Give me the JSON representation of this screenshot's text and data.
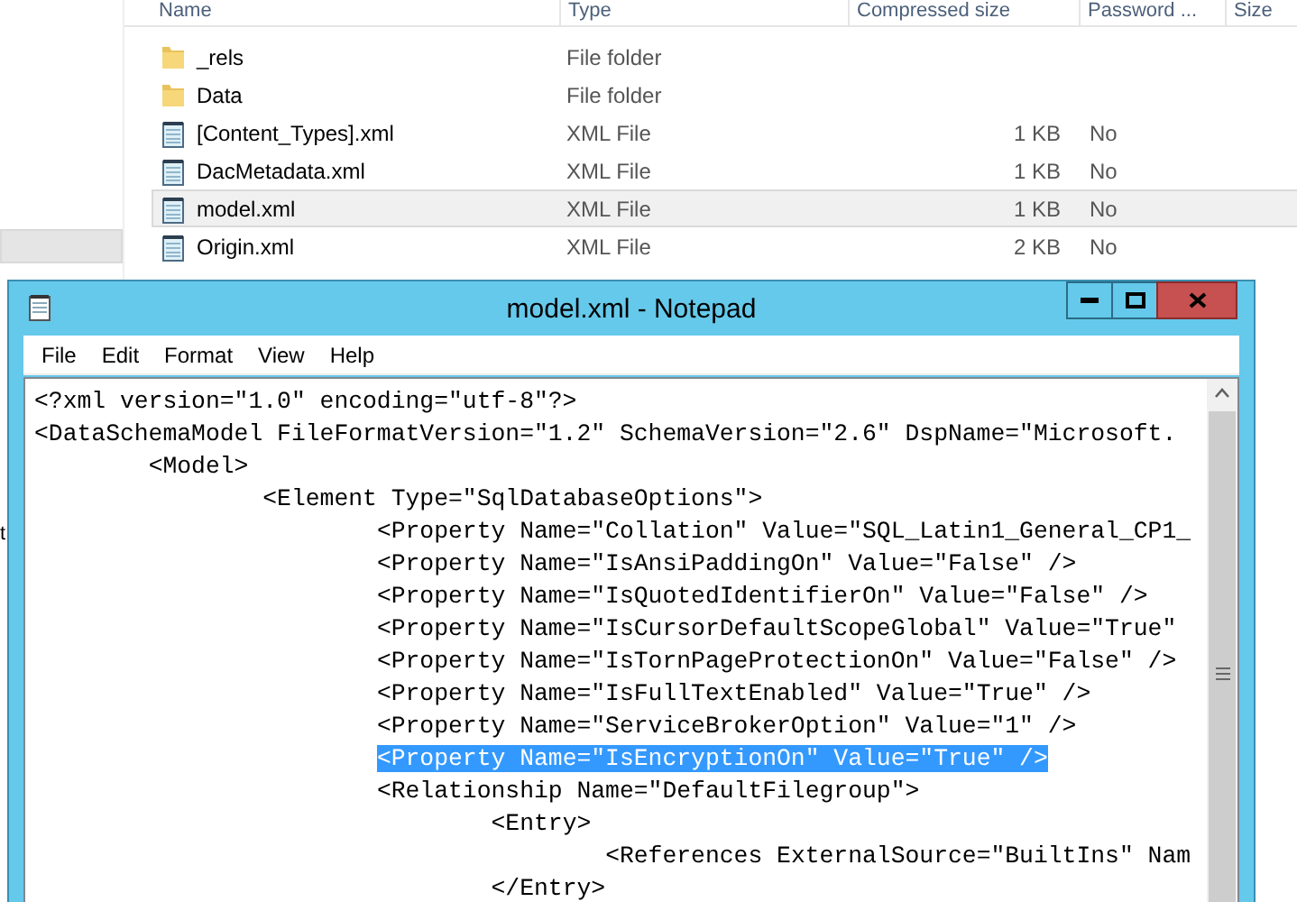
{
  "explorer": {
    "columns": [
      "Name",
      "Type",
      "Compressed size",
      "Password ...",
      "Size"
    ],
    "rows": [
      {
        "kind": "folder",
        "name": "_rels",
        "type": "File folder",
        "selected": false
      },
      {
        "kind": "folder",
        "name": "Data",
        "type": "File folder",
        "selected": false
      },
      {
        "kind": "file",
        "name": "[Content_Types].xml",
        "type": "XML File",
        "compressed_size": "1 KB",
        "password": "No",
        "selected": false
      },
      {
        "kind": "file",
        "name": "DacMetadata.xml",
        "type": "XML File",
        "compressed_size": "1 KB",
        "password": "No",
        "selected": false
      },
      {
        "kind": "file",
        "name": "model.xml",
        "type": "XML File",
        "compressed_size": "1 KB",
        "password": "No",
        "selected": true
      },
      {
        "kind": "file",
        "name": "Origin.xml",
        "type": "XML File",
        "compressed_size": "2 KB",
        "password": "No",
        "selected": false
      }
    ],
    "nav_pane": {
      "items": [
        {
          "selected": true
        }
      ],
      "cut_text": "t"
    }
  },
  "notepad": {
    "title": "model.xml - Notepad",
    "menu": [
      "File",
      "Edit",
      "Format",
      "View",
      "Help"
    ],
    "lines": [
      {
        "text": "<?xml version=\"1.0\" encoding=\"utf-8\"?>",
        "selected": false
      },
      {
        "text": "<DataSchemaModel FileFormatVersion=\"1.2\" SchemaVersion=\"2.6\" DspName=\"Microsoft.",
        "selected": false
      },
      {
        "text": "\t<Model>",
        "selected": false
      },
      {
        "text": "\t\t<Element Type=\"SqlDatabaseOptions\">",
        "selected": false
      },
      {
        "text": "\t\t\t<Property Name=\"Collation\" Value=\"SQL_Latin1_General_CP1_",
        "selected": false
      },
      {
        "text": "\t\t\t<Property Name=\"IsAnsiPaddingOn\" Value=\"False\" />",
        "selected": false
      },
      {
        "text": "\t\t\t<Property Name=\"IsQuotedIdentifierOn\" Value=\"False\" />",
        "selected": false
      },
      {
        "text": "\t\t\t<Property Name=\"IsCursorDefaultScopeGlobal\" Value=\"True\"",
        "selected": false
      },
      {
        "text": "\t\t\t<Property Name=\"IsTornPageProtectionOn\" Value=\"False\" />",
        "selected": false
      },
      {
        "text": "\t\t\t<Property Name=\"IsFullTextEnabled\" Value=\"True\" />",
        "selected": false
      },
      {
        "text": "\t\t\t<Property Name=\"ServiceBrokerOption\" Value=\"1\" />",
        "selected": false
      },
      {
        "text": "\t\t\t<Property Name=\"IsEncryptionOn\" Value=\"True\" />",
        "selected": true
      },
      {
        "text": "\t\t\t<Relationship Name=\"DefaultFilegroup\">",
        "selected": false
      },
      {
        "text": "\t\t\t\t<Entry>",
        "selected": false
      },
      {
        "text": "\t\t\t\t\t<References ExternalSource=\"BuiltIns\" Nam",
        "selected": false
      },
      {
        "text": "\t\t\t\t</Entry>",
        "selected": false
      }
    ]
  }
}
